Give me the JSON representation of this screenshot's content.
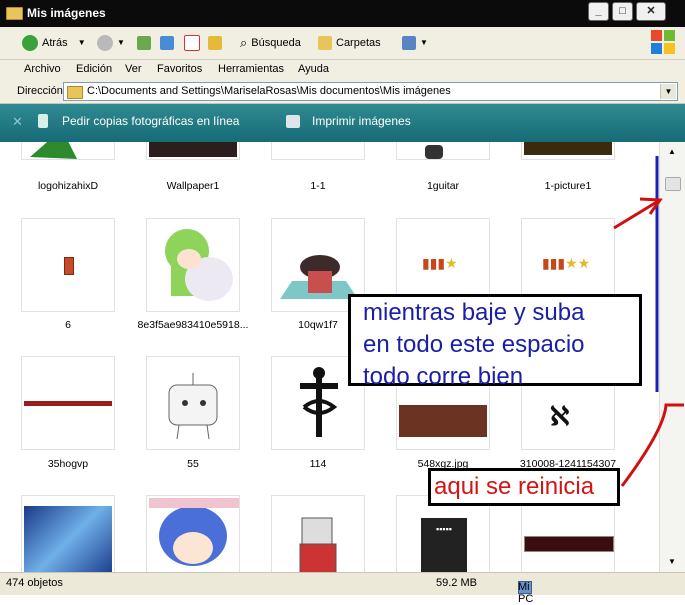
{
  "window": {
    "title": "Mis imágenes"
  },
  "toolbar": {
    "back": "Atrás",
    "search": "Búsqueda",
    "folders": "Carpetas"
  },
  "menu": [
    "Archivo",
    "Edición",
    "Ver",
    "Favoritos",
    "Herramientas",
    "Ayuda"
  ],
  "address": {
    "label": "Dirección",
    "path": "C:\\Documents and Settings\\MariselaRosas\\Mis documentos\\Mis imágenes"
  },
  "tasks": {
    "order_prints": "Pedir copias fotográficas en línea",
    "print_images": "Imprimir imágenes"
  },
  "files": [
    {
      "name": "logohizahixD"
    },
    {
      "name": "Wallpaper1"
    },
    {
      "name": "1-1"
    },
    {
      "name": "1guitar"
    },
    {
      "name": "1-picture1"
    },
    {
      "name": "6"
    },
    {
      "name": "8e3f5ae983410e5918..."
    },
    {
      "name": "10qw1f7"
    },
    {
      "name": ""
    },
    {
      "name": ""
    },
    {
      "name": "35hogvp"
    },
    {
      "name": "55"
    },
    {
      "name": "114"
    },
    {
      "name": "548xgz.jpg"
    },
    {
      "name": "310008-1241154307"
    }
  ],
  "annotations": {
    "note1_lines": [
      "mientras baje y suba",
      "en todo este espacio",
      "todo corre bien"
    ],
    "note2": "aqui se reinicia"
  },
  "status": {
    "count": "474 objetos",
    "size": "59.2 MB",
    "location": "Mi PC"
  },
  "colors": {
    "titlebar": "#0b0b0b",
    "taskbar": "#1f7b84",
    "note_blue": "#1a1fa6",
    "note_red": "#d21414"
  }
}
